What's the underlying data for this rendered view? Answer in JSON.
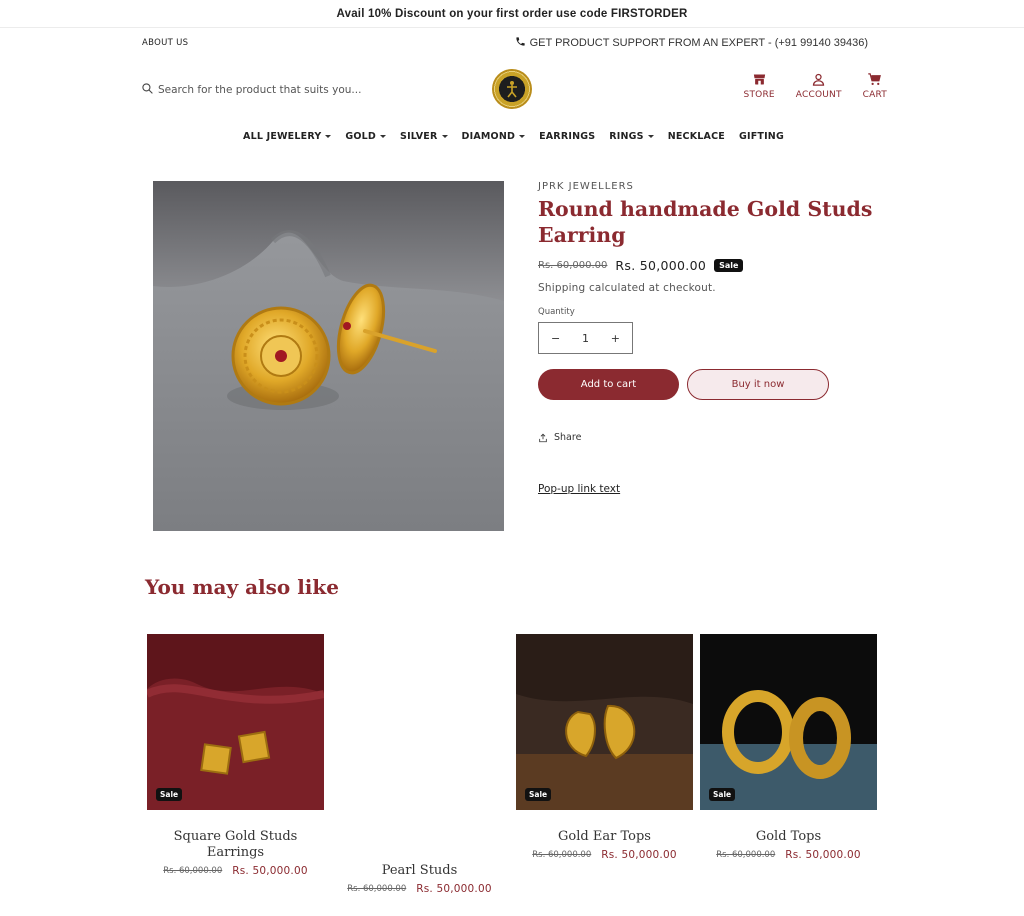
{
  "announcement": "Avail 10% Discount on your first order use code FIRSTORDER",
  "topbar": {
    "about": "ABOUT US",
    "support": "GET PRODUCT SUPPORT FROM AN EXPERT - (+91 99140 39436)"
  },
  "header": {
    "search_placeholder": "Search for the product that suits you...",
    "icons": {
      "store": "STORE",
      "account": "ACCOUNT",
      "cart": "CART"
    }
  },
  "nav": {
    "items": [
      {
        "label": "ALL JEWELERY",
        "dropdown": true
      },
      {
        "label": "GOLD",
        "dropdown": true
      },
      {
        "label": "SILVER",
        "dropdown": true
      },
      {
        "label": "DIAMOND",
        "dropdown": true
      },
      {
        "label": "EARRINGS",
        "dropdown": false
      },
      {
        "label": "RINGS",
        "dropdown": true
      },
      {
        "label": "NECKLACE",
        "dropdown": false
      },
      {
        "label": "GIFTING",
        "dropdown": false
      }
    ]
  },
  "product": {
    "vendor": "JPRK JEWELLERS",
    "title": "Round handmade Gold Studs Earring",
    "compare_price": "Rs. 60,000.00",
    "price": "Rs. 50,000.00",
    "badge": "Sale",
    "shipping": "Shipping calculated at checkout.",
    "quantity_label": "Quantity",
    "quantity": "1",
    "minus": "−",
    "plus": "+",
    "add_to_cart": "Add to cart",
    "buy_now": "Buy it now",
    "share": "Share",
    "popup_link": "Pop-up link text"
  },
  "related": {
    "heading": "You may also like",
    "items": [
      {
        "name": "Square Gold Studs Earrings",
        "compare_price": "Rs. 60,000.00",
        "price": "Rs. 50,000.00",
        "badge": "Sale"
      },
      {
        "name": "Pearl Studs",
        "compare_price": "Rs. 60,000.00",
        "price": "Rs. 50,000.00",
        "badge": ""
      },
      {
        "name": "Gold Ear Tops",
        "compare_price": "Rs. 60,000.00",
        "price": "Rs. 50,000.00",
        "badge": "Sale"
      },
      {
        "name": "Gold Tops",
        "compare_price": "Rs. 60,000.00",
        "price": "Rs. 50,000.00",
        "badge": "Sale"
      }
    ]
  },
  "colors": {
    "brand": "#8b2a30",
    "badge": "#111111",
    "buy_now_bg": "#f6eaec"
  }
}
